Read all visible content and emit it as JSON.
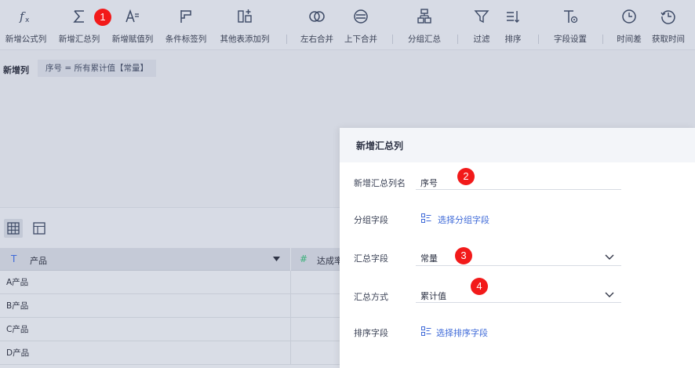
{
  "toolbar": {
    "items": [
      {
        "label": "新增公式列",
        "icon": "fx-icon"
      },
      {
        "label": "新增汇总列",
        "icon": "sigma-icon"
      },
      {
        "label": "新增赋值列",
        "icon": "assign-value-icon"
      },
      {
        "label": "条件标签列",
        "icon": "flag-icon"
      },
      {
        "label": "其他表添加列",
        "icon": "add-column-icon"
      },
      {
        "label": "左右合并",
        "icon": "horizontal-merge-icon"
      },
      {
        "label": "上下合并",
        "icon": "vertical-merge-icon"
      },
      {
        "label": "分组汇总",
        "icon": "group-summary-icon"
      },
      {
        "label": "过滤",
        "icon": "filter-icon"
      },
      {
        "label": "排序",
        "icon": "sort-icon"
      },
      {
        "label": "字段设置",
        "icon": "field-settings-icon"
      },
      {
        "label": "时间差",
        "icon": "clock-icon"
      },
      {
        "label": "获取时间",
        "icon": "get-time-icon"
      }
    ]
  },
  "formula": {
    "title": "新增列",
    "expression": "序号 = 所有累计值【常量】"
  },
  "view": {
    "icons": [
      "grid-view-icon",
      "layout-view-icon"
    ]
  },
  "table": {
    "columns": [
      {
        "type_icon": "T",
        "name": "产品"
      },
      {
        "type_icon": "#",
        "name": "达成率"
      }
    ],
    "rows": [
      "A产品",
      "B产品",
      "C产品",
      "D产品"
    ]
  },
  "dialog": {
    "title": "新增汇总列",
    "name_label": "新增汇总列名",
    "name_value": "序号",
    "group_label": "分组字段",
    "group_link": "选择分组字段",
    "summary_field_label": "汇总字段",
    "summary_field_value": "常量",
    "summary_method_label": "汇总方式",
    "summary_method_value": "累计值",
    "sort_label": "排序字段",
    "sort_link": "选择排序字段"
  },
  "badges": [
    "1",
    "2",
    "3",
    "4"
  ],
  "colors": {
    "accent": "#3f6ad8",
    "badge": "#f21a1a",
    "icon": "#3d4a66"
  }
}
